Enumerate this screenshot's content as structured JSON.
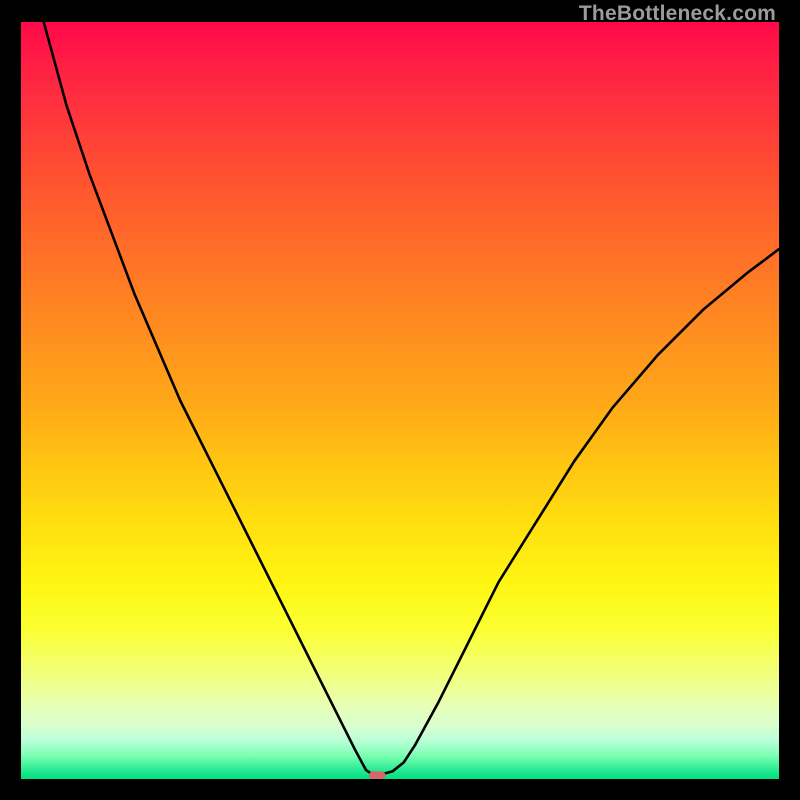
{
  "watermark": "TheBottleneck.com",
  "chart_data": {
    "type": "line",
    "title": "",
    "xlabel": "",
    "ylabel": "",
    "xlim": [
      0,
      100
    ],
    "ylim": [
      0,
      100
    ],
    "grid": false,
    "legend": false,
    "gradient_bands": [
      {
        "y_pct": 0,
        "color": "#ff094a"
      },
      {
        "y_pct": 10,
        "color": "#ff2e40"
      },
      {
        "y_pct": 20,
        "color": "#ff5030"
      },
      {
        "y_pct": 30,
        "color": "#ff6e28"
      },
      {
        "y_pct": 40,
        "color": "#ff8b20"
      },
      {
        "y_pct": 50,
        "color": "#ffa718"
      },
      {
        "y_pct": 58,
        "color": "#ffc312"
      },
      {
        "y_pct": 66,
        "color": "#ffde10"
      },
      {
        "y_pct": 74,
        "color": "#fff512"
      },
      {
        "y_pct": 80,
        "color": "#fbff30"
      },
      {
        "y_pct": 86,
        "color": "#f2ff7a"
      },
      {
        "y_pct": 90,
        "color": "#e8ffb0"
      },
      {
        "y_pct": 93,
        "color": "#d8ffd0"
      },
      {
        "y_pct": 95,
        "color": "#b8ffd8"
      },
      {
        "y_pct": 97,
        "color": "#78ffb0"
      },
      {
        "y_pct": 99,
        "color": "#20e890"
      },
      {
        "y_pct": 100,
        "color": "#00e080"
      }
    ],
    "series": [
      {
        "name": "bottleneck-curve",
        "x": [
          0,
          3,
          6,
          9,
          12,
          15,
          18,
          21,
          24,
          27,
          30,
          33,
          36,
          39,
          42,
          44,
          45.5,
          46.5,
          47.5,
          49,
          50.5,
          52,
          55,
          59,
          63,
          68,
          73,
          78,
          84,
          90,
          96,
          100
        ],
        "y": [
          113,
          100,
          89,
          80,
          72,
          64,
          57,
          50,
          44,
          38,
          32,
          26,
          20,
          14,
          8,
          4,
          1.2,
          0.5,
          0.6,
          1.0,
          2.2,
          4.5,
          10,
          18,
          26,
          34,
          42,
          49,
          56,
          62,
          67,
          70
        ]
      }
    ],
    "marker": {
      "name": "optimal-point",
      "x": 47,
      "y": 0.5,
      "color": "#d56767",
      "shape": "rounded-rect",
      "width_pct": 2.2,
      "height_pct": 1.0
    }
  }
}
